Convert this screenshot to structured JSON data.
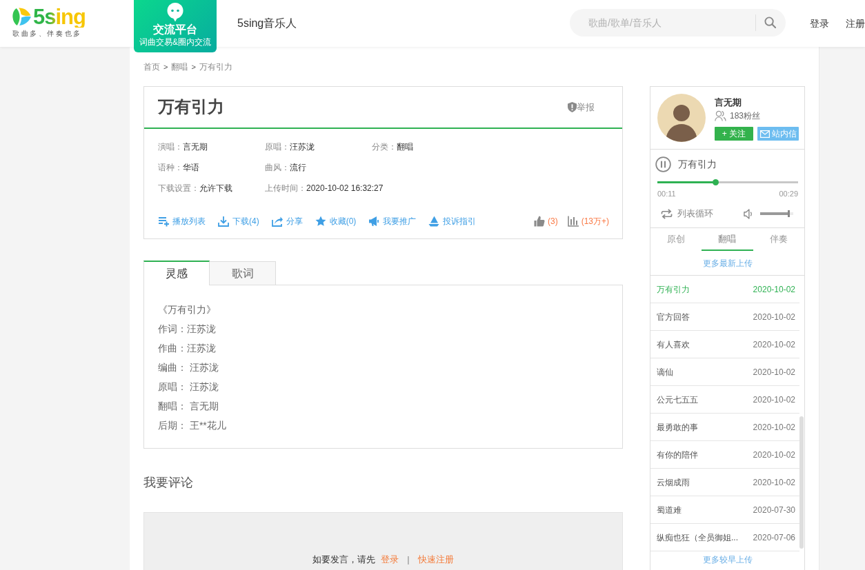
{
  "header": {
    "logo": {
      "name": "5sing",
      "slogan": "歌曲多、伴奏也多"
    },
    "promo": {
      "title": "交流平台",
      "subtitle": "词曲交易&圈内交流"
    },
    "nav_link": "5sing音乐人",
    "search": {
      "placeholder": "歌曲/歌单/音乐人"
    },
    "account_links": [
      "登录",
      "注册"
    ]
  },
  "breadcrumb": [
    {
      "label": "首页",
      "separator": ">"
    },
    {
      "label": "翻唱",
      "separator": ">"
    },
    {
      "label": "万有引力"
    }
  ],
  "song": {
    "title": "万有引力",
    "report": "举报",
    "info_rows": [
      [
        {
          "label": "演唱：",
          "value": "言无期"
        },
        {
          "label": "原唱：",
          "value": "汪苏泷"
        },
        {
          "label": "分类：",
          "value": "翻唱"
        }
      ],
      [
        {
          "label": "语种：",
          "value": "华语"
        },
        {
          "label": "曲风：",
          "value": "流行"
        }
      ],
      [
        {
          "label": "下载设置：",
          "value": "允许下载"
        },
        {
          "label": "上传时间：",
          "value": "2020-10-02 16:32:27"
        }
      ]
    ],
    "actions": [
      {
        "kind": "playlist",
        "label": "播放列表"
      },
      {
        "kind": "download",
        "label": "下载(4)"
      },
      {
        "kind": "share",
        "label": "分享"
      },
      {
        "kind": "favorite",
        "label": "收藏(0)"
      },
      {
        "kind": "promote",
        "label": "我要推广"
      },
      {
        "kind": "complaint",
        "label": "投诉指引"
      }
    ],
    "stats": [
      {
        "kind": "likes",
        "value": "(3)"
      },
      {
        "kind": "plays",
        "value": "(13万+)"
      }
    ]
  },
  "tabs": [
    {
      "label": "灵感",
      "selected": true
    },
    {
      "label": "歌词",
      "selected": false
    }
  ],
  "inspiration": [
    "《万有引力》",
    "作词：汪苏泷",
    "作曲：汪苏泷",
    "编曲： 汪苏泷",
    "原唱： 汪苏泷",
    "翻唱： 言无期",
    "后期： 王**花儿"
  ],
  "comments": {
    "heading": "我要评论",
    "prompt": "如要发言，请先",
    "login": "登录",
    "divider": "|",
    "register": "快速注册"
  },
  "sidebar": {
    "artist": {
      "name": "言无期",
      "fans": "183粉丝",
      "follow": "+ 关注",
      "message": "站内信"
    },
    "player": {
      "title": "万有引力",
      "playing": true,
      "level": 0.41,
      "elapsed": "00:11",
      "duration": "00:29",
      "loop_mode": "列表循环",
      "volume": {
        "level": 0.88
      }
    },
    "upload_tabs": [
      {
        "label": "原创",
        "selected": false
      },
      {
        "label": "翻唱",
        "selected": true
      },
      {
        "label": "伴奏",
        "selected": false
      }
    ],
    "more_recent": "更多最新上传",
    "songs": [
      {
        "title": "万有引力",
        "date": "2020-10-02",
        "selected": true
      },
      {
        "title": "官方回答",
        "date": "2020-10-02",
        "selected": false
      },
      {
        "title": "有人喜欢",
        "date": "2020-10-02",
        "selected": false
      },
      {
        "title": "谪仙",
        "date": "2020-10-02",
        "selected": false
      },
      {
        "title": "公元七五五",
        "date": "2020-10-02",
        "selected": false
      },
      {
        "title": "最勇敢的事",
        "date": "2020-10-02",
        "selected": false
      },
      {
        "title": "有你的陪伴",
        "date": "2020-10-02",
        "selected": false
      },
      {
        "title": "云烟成雨",
        "date": "2020-10-02",
        "selected": false
      },
      {
        "title": "蜀道难",
        "date": "2020-07-30",
        "selected": false
      },
      {
        "title": "纵痴也狂（全员御姐...",
        "date": "2020-07-06",
        "selected": false
      }
    ],
    "more_older": "更多较早上传"
  }
}
